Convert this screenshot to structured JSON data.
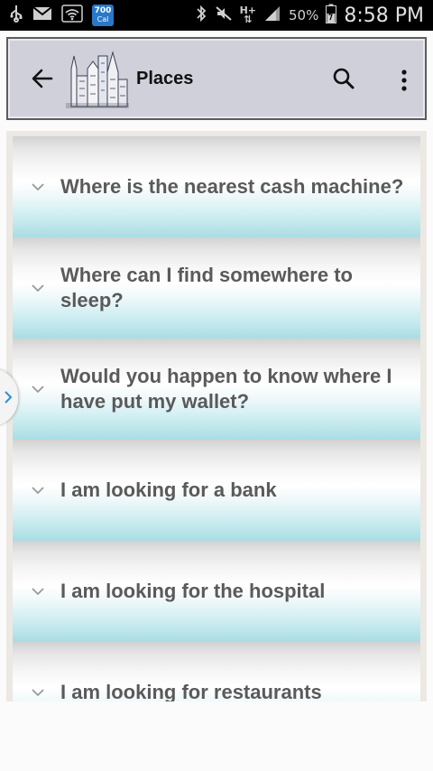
{
  "status_bar": {
    "calendar_badge_top": "700",
    "calendar_badge_bottom": "Cal",
    "battery_percent": "50%",
    "time": "8:58 PM",
    "icons": [
      "usb-icon",
      "mail-icon",
      "wifi-icon",
      "bluetooth-icon",
      "mute-icon",
      "hplus-icon",
      "signal-icon",
      "battery-icon"
    ]
  },
  "app_bar": {
    "title": "Places",
    "back_icon": "arrow-left-icon",
    "search_icon": "search-icon",
    "more_icon": "more-vert-icon",
    "logo_icon": "city-buildings-logo"
  },
  "phrases": [
    {
      "text": "Where is the nearest cash machine?"
    },
    {
      "text": "Where can I find somewhere to sleep?"
    },
    {
      "text": "Would you happen to know where I have put my wallet?"
    },
    {
      "text": "I am looking for a bank"
    },
    {
      "text": "I am looking for the hospital"
    },
    {
      "text": "I am looking for restaurants"
    }
  ],
  "colors": {
    "app_bar_bg": "#cfd0d9",
    "row_gradient_bottom": "#a9dde3",
    "label_text": "#5a5a5a",
    "frame_bg": "#ece8e4"
  }
}
